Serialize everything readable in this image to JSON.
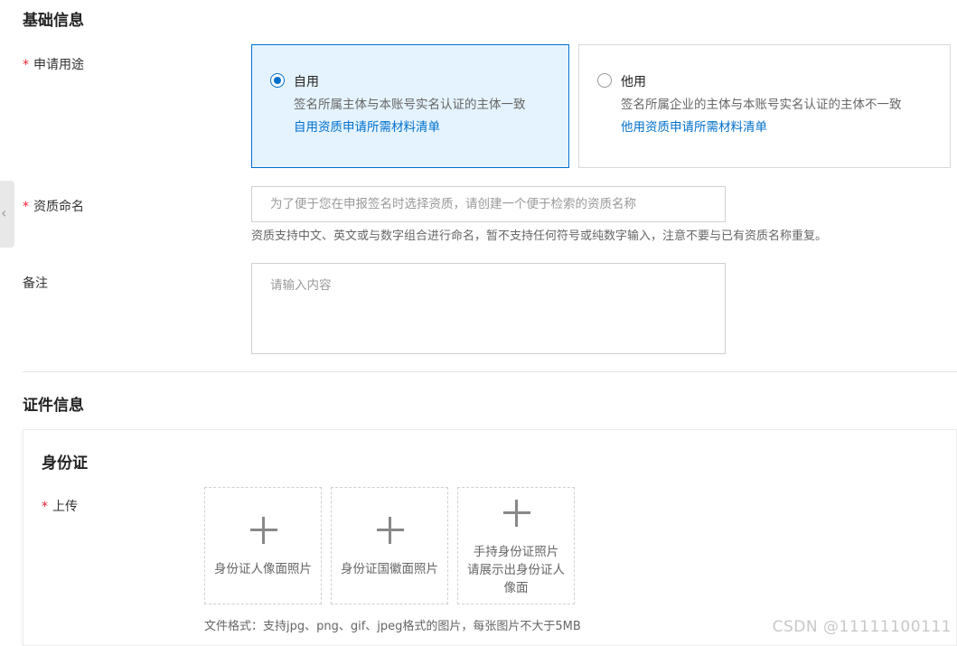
{
  "basic_info": {
    "title": "基础信息",
    "purpose": {
      "label": "申请用途",
      "required_mark": "*",
      "options": [
        {
          "title": "自用",
          "desc": "签名所属主体与本账号实名认证的主体一致",
          "link": "自用资质申请所需材料清单",
          "selected": true
        },
        {
          "title": "他用",
          "desc": "签名所属企业的主体与本账号实名认证的主体不一致",
          "link": "他用资质申请所需材料清单",
          "selected": false
        }
      ]
    },
    "qualification_name": {
      "label": "资质命名",
      "required_mark": "*",
      "placeholder": "为了便于您在申报签名时选择资质，请创建一个便于检索的资质名称",
      "help": "资质支持中文、英文或与数字组合进行命名，暂不支持任何符号或纯数字输入，注意不要与已有资质名称重复。"
    },
    "remark": {
      "label": "备注",
      "placeholder": "请输入内容"
    }
  },
  "certificate_info": {
    "title": "证件信息",
    "id_card": {
      "title": "身份证",
      "upload_label": "上传",
      "required_mark": "*",
      "boxes": [
        {
          "label": "身份证人像面照片"
        },
        {
          "label": "身份证国徽面照片"
        },
        {
          "label": "手持身份证照片\n请展示出身份证人\n像面"
        }
      ],
      "format_hint": "文件格式：支持jpg、png、gif、jpeg格式的图片，每张图片不大于5MB"
    }
  },
  "side_tab": {
    "icon": "chevron-left-icon",
    "glyph": "‹"
  },
  "watermark": "CSDN @11111100111",
  "colors": {
    "accent": "#0070cc",
    "selected_bg": "#e5f3ff",
    "required": "#ee2233"
  }
}
